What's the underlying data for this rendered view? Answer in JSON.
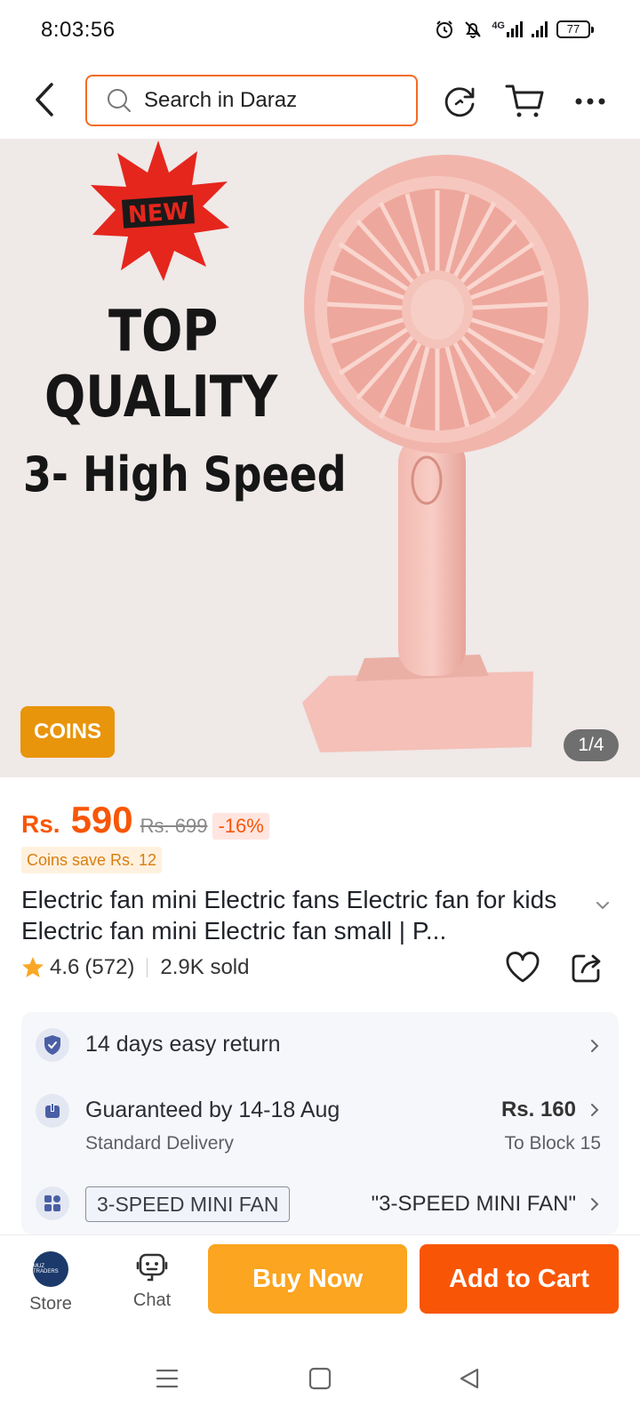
{
  "status_bar": {
    "time": "8:03:56",
    "network": "4G",
    "battery": "77",
    "icons": [
      "alarm-icon",
      "bell-off-icon",
      "signal-4g-icon",
      "signal-icon",
      "battery-icon"
    ]
  },
  "header": {
    "search_placeholder": "Search in Daraz",
    "icons": [
      "back-icon",
      "search-icon",
      "history-icon",
      "cart-icon",
      "more-icon"
    ]
  },
  "hero": {
    "badge_new": "NEW",
    "line1": "TOP",
    "line2": "QUALITY",
    "line3": "3- High Speed",
    "coins_badge": "COINS",
    "image_counter": "1/4"
  },
  "product": {
    "currency": "Rs.",
    "price": "590",
    "old_price": "Rs. 699",
    "discount": "-16%",
    "coins_save": "Coins save Rs. 12",
    "title": "Electric fan mini Electric fans Electric fan for kids Electric fan mini Electric fan small | P...",
    "rating": "4.6",
    "reviews": "(572)",
    "sold": "2.9K sold"
  },
  "info": {
    "return_text": "14 days easy return",
    "delivery_text": "Guaranteed by 14-18 Aug",
    "delivery_type": "Standard Delivery",
    "delivery_fee": "Rs. 160",
    "delivery_to": "To Block 15",
    "variant_chip": "3-SPEED MINI FAN",
    "variant_selected": "\"3-SPEED MINI FAN\""
  },
  "bottom_bar": {
    "store_label": "Store",
    "chat_label": "Chat",
    "buy_now": "Buy Now",
    "add_to_cart": "Add to Cart",
    "store_logo_text": "MUZ TRADERS"
  },
  "colors": {
    "accent": "#f85606",
    "buy_now": "#fba520",
    "coins": "#e8950c"
  }
}
